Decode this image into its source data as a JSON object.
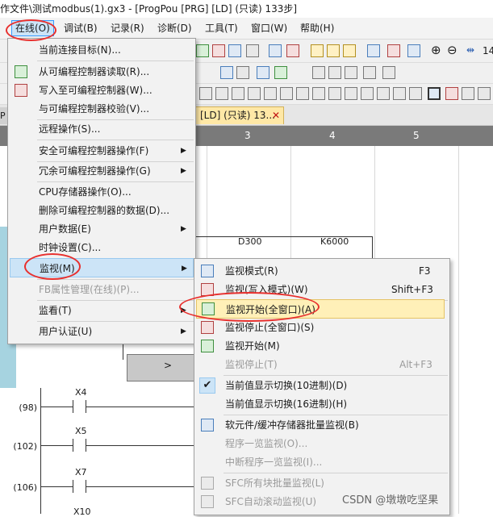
{
  "window": {
    "title": "作文件\\测试modbus(1).gx3 - [ProgPou [PRG] [LD] (只读) 133步]"
  },
  "menubar": {
    "items": [
      "在线(O)",
      "调试(B)",
      "记录(R)",
      "诊断(D)",
      "工具(T)",
      "窗口(W)",
      "帮助(H)"
    ]
  },
  "toolbar": {
    "zoom_value": "14"
  },
  "tabs": {
    "left_fragment": "P",
    "active": "[LD] (只读) 13...",
    "close": "✕"
  },
  "columns": {
    "labels": [
      "3",
      "4",
      "5"
    ]
  },
  "ladder": {
    "d300": "D300",
    "k6000": "K6000",
    "compare_symbol": ">",
    "rungs": [
      {
        "step": "(98)",
        "contact": "X4"
      },
      {
        "step": "(102)",
        "contact": "X5"
      },
      {
        "step": "(106)",
        "contact": "X7"
      },
      {
        "step": "",
        "contact": "X10"
      }
    ]
  },
  "online_menu": {
    "items": [
      {
        "label": "当前连接目标(N)...",
        "icon": "",
        "submenu": false,
        "disabled": false
      },
      {
        "label": "从可编程控制器读取(R)...",
        "icon": "read-from-plc-icon",
        "submenu": false,
        "disabled": false
      },
      {
        "label": "写入至可编程控制器(W)...",
        "icon": "write-to-plc-icon",
        "submenu": false,
        "disabled": false
      },
      {
        "label": "与可编程控制器校验(V)...",
        "icon": "",
        "submenu": false,
        "disabled": false
      },
      {
        "label": "远程操作(S)...",
        "icon": "",
        "submenu": false,
        "disabled": false
      },
      {
        "label": "安全可编程控制器操作(F)",
        "icon": "",
        "submenu": true,
        "disabled": false
      },
      {
        "label": "冗余可编程控制器操作(G)",
        "icon": "",
        "submenu": true,
        "disabled": false
      },
      {
        "label": "CPU存储器操作(O)...",
        "icon": "",
        "submenu": false,
        "disabled": false
      },
      {
        "label": "删除可编程控制器的数据(D)...",
        "icon": "",
        "submenu": false,
        "disabled": false
      },
      {
        "label": "用户数据(E)",
        "icon": "",
        "submenu": true,
        "disabled": false
      },
      {
        "label": "时钟设置(C)...",
        "icon": "",
        "submenu": false,
        "disabled": false
      },
      {
        "label": "监视(M)",
        "icon": "",
        "submenu": true,
        "disabled": false,
        "highlighted": true
      },
      {
        "label": "FB属性管理(在线)(P)...",
        "icon": "",
        "submenu": false,
        "disabled": true
      },
      {
        "label": "监看(T)",
        "icon": "",
        "submenu": true,
        "disabled": false
      },
      {
        "label": "用户认证(U)",
        "icon": "",
        "submenu": true,
        "disabled": false
      }
    ]
  },
  "monitor_menu": {
    "items": [
      {
        "label": "监视模式(R)",
        "shortcut": "F3",
        "icon": "monitor-mode-icon",
        "disabled": false
      },
      {
        "label": "监视(写入模式)(W)",
        "shortcut": "Shift+F3",
        "icon": "monitor-write-mode-icon",
        "disabled": false
      },
      {
        "label": "监视开始(全窗口)(A)",
        "shortcut": "",
        "icon": "monitor-start-all-icon",
        "disabled": false,
        "highlighted": true
      },
      {
        "label": "监视停止(全窗口)(S)",
        "shortcut": "",
        "icon": "monitor-stop-all-icon",
        "disabled": false
      },
      {
        "label": "监视开始(M)",
        "shortcut": "",
        "icon": "monitor-start-icon",
        "disabled": false
      },
      {
        "label": "监视停止(T)",
        "shortcut": "Alt+F3",
        "icon": "monitor-stop-icon",
        "disabled": true
      },
      {
        "label": "当前值显示切换(10进制)(D)",
        "shortcut": "",
        "icon": "checkmark-icon",
        "disabled": false
      },
      {
        "label": "当前值显示切换(16进制)(H)",
        "shortcut": "",
        "icon": "",
        "disabled": false
      },
      {
        "label": "软元件/缓冲存储器批量监视(B)",
        "shortcut": "",
        "icon": "device-batch-monitor-icon",
        "disabled": false
      },
      {
        "label": "程序一览监视(O)...",
        "shortcut": "",
        "icon": "",
        "disabled": true
      },
      {
        "label": "中断程序一览监视(I)...",
        "shortcut": "",
        "icon": "",
        "disabled": true
      },
      {
        "label": "SFC所有块批量监视(L)",
        "shortcut": "",
        "icon": "sfc-batch-monitor-icon",
        "disabled": true
      },
      {
        "label": "SFC自动滚动监视(U)",
        "shortcut": "",
        "icon": "sfc-auto-scroll-icon",
        "disabled": true
      }
    ]
  },
  "watermark": "CSDN @墩墩吃坚果"
}
